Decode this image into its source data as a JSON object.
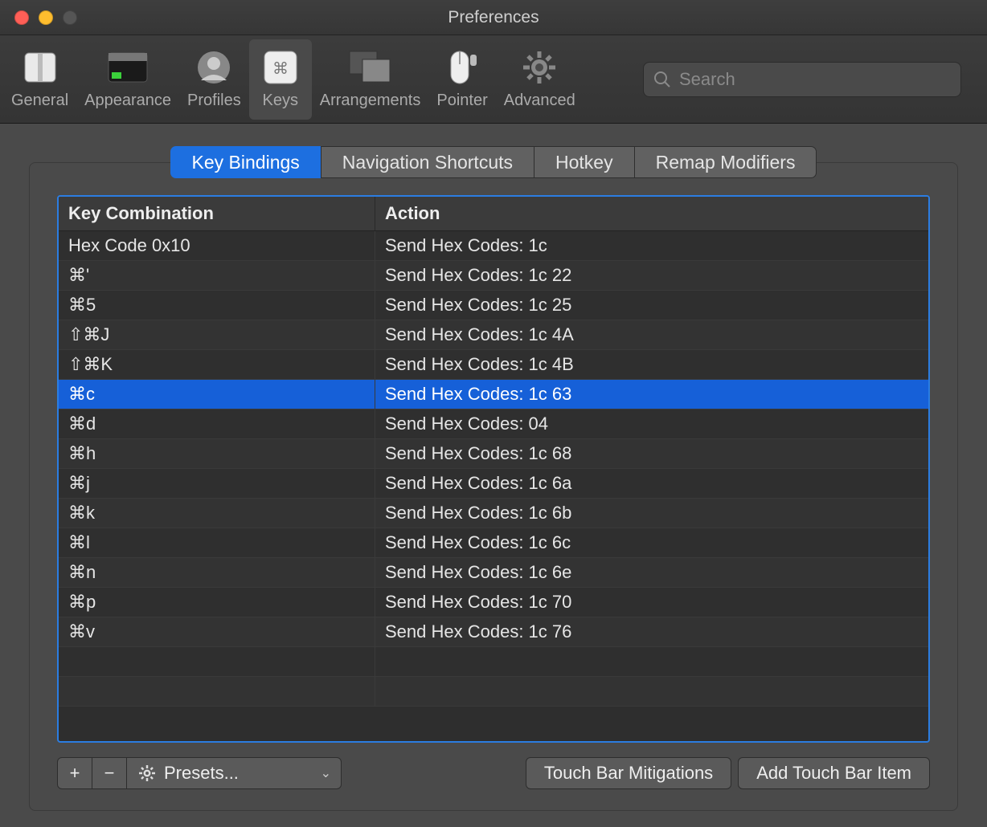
{
  "window": {
    "title": "Preferences"
  },
  "toolbar": {
    "items": [
      {
        "label": "General"
      },
      {
        "label": "Appearance"
      },
      {
        "label": "Profiles"
      },
      {
        "label": "Keys"
      },
      {
        "label": "Arrangements"
      },
      {
        "label": "Pointer"
      },
      {
        "label": "Advanced"
      }
    ],
    "selected_index": 3,
    "search_placeholder": "Search"
  },
  "subtabs": {
    "items": [
      {
        "label": "Key Bindings"
      },
      {
        "label": "Navigation Shortcuts"
      },
      {
        "label": "Hotkey"
      },
      {
        "label": "Remap Modifiers"
      }
    ],
    "active_index": 0
  },
  "table": {
    "headers": [
      "Key Combination",
      "Action"
    ],
    "selected_index": 5,
    "rows": [
      {
        "combo": "Hex Code 0x10",
        "action": "Send Hex Codes: 1c"
      },
      {
        "combo": "⌘'",
        "action": "Send Hex Codes: 1c 22"
      },
      {
        "combo": "⌘5",
        "action": "Send Hex Codes: 1c 25"
      },
      {
        "combo": "⇧⌘J",
        "action": "Send Hex Codes: 1c 4A"
      },
      {
        "combo": "⇧⌘K",
        "action": "Send Hex Codes: 1c 4B"
      },
      {
        "combo": "⌘c",
        "action": "Send Hex Codes: 1c 63"
      },
      {
        "combo": "⌘d",
        "action": "Send Hex Codes: 04"
      },
      {
        "combo": "⌘h",
        "action": "Send Hex Codes: 1c 68"
      },
      {
        "combo": "⌘j",
        "action": "Send Hex Codes: 1c 6a"
      },
      {
        "combo": "⌘k",
        "action": "Send Hex Codes: 1c 6b"
      },
      {
        "combo": "⌘l",
        "action": "Send Hex Codes: 1c 6c"
      },
      {
        "combo": "⌘n",
        "action": "Send Hex Codes: 1c 6e"
      },
      {
        "combo": "⌘p",
        "action": "Send Hex Codes: 1c 70"
      },
      {
        "combo": "⌘v",
        "action": "Send Hex Codes: 1c 76"
      }
    ],
    "empty_rows": 2
  },
  "footer": {
    "add_label": "+",
    "remove_label": "−",
    "presets_label": "Presets...",
    "touch_bar_mitigations_label": "Touch Bar Mitigations",
    "add_touch_bar_item_label": "Add Touch Bar Item"
  }
}
